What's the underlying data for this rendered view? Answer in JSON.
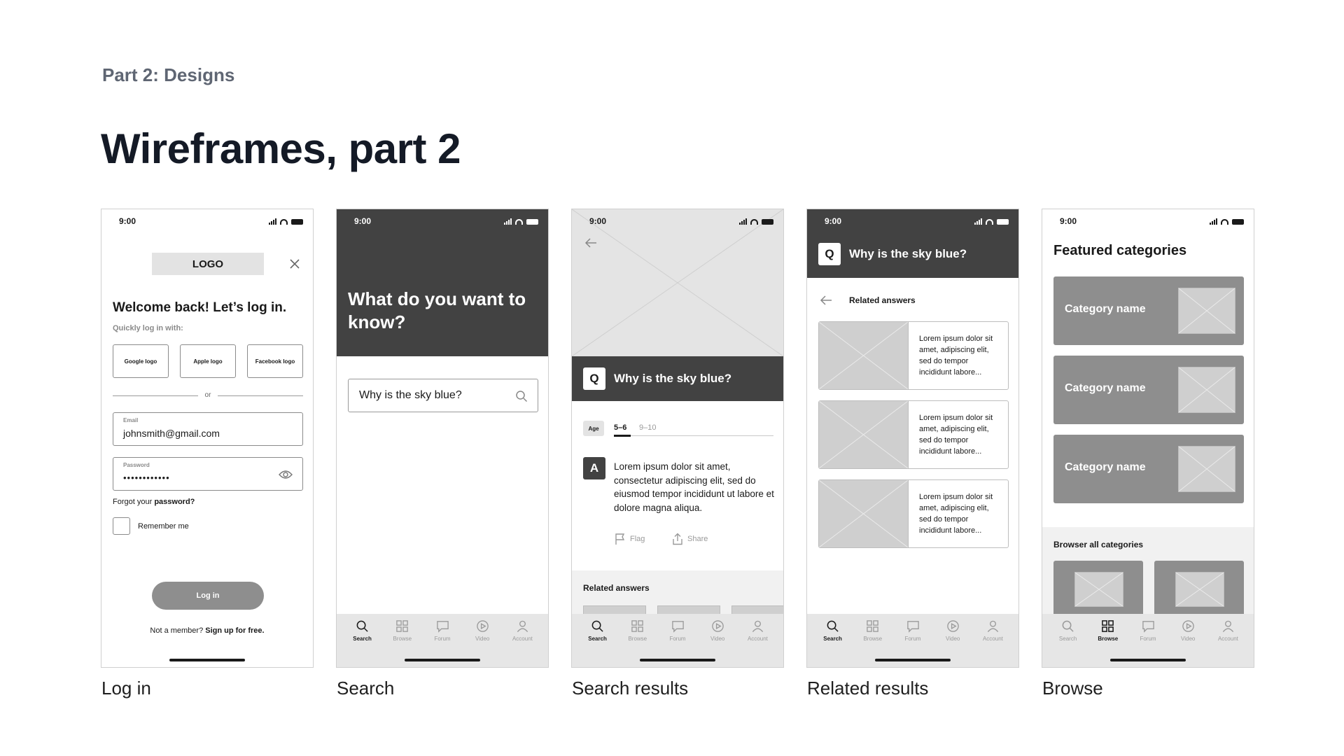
{
  "header": {
    "eyebrow": "Part 2: Designs",
    "title": "Wireframes, part 2"
  },
  "status_time": "9:00",
  "tabbar": [
    "Search",
    "Browse",
    "Forum",
    "Video",
    "Account"
  ],
  "screens": {
    "login": {
      "caption": "Log in",
      "logo": "LOGO",
      "heading": "Welcome back! Let’s log in.",
      "subheading": "Quickly log in with:",
      "social": [
        "Google logo",
        "Apple logo",
        "Facebook logo"
      ],
      "or": "or",
      "email_label": "Email",
      "email_value": "johnsmith@gmail.com",
      "password_label": "Password",
      "password_value": "••••••••••••",
      "forgot_prefix": "Forgot your ",
      "forgot_link": "password?",
      "remember": "Remember me",
      "login_button": "Log in",
      "signup_prefix": "Not a member? ",
      "signup_link": "Sign up for free."
    },
    "search": {
      "caption": "Search",
      "hero_question": "What do you want to know?",
      "search_value": "Why is the sky blue?"
    },
    "results": {
      "caption": "Search results",
      "question": "Why is the sky blue?",
      "q_badge": "Q",
      "a_badge": "A",
      "age_chip": "Age",
      "age_options": [
        "5–6",
        "9–10"
      ],
      "answer": "Lorem ipsum dolor sit amet, consectetur adipiscing elit, sed do eiusmod tempor incididunt ut labore et dolore magna aliqua.",
      "flag": "Flag",
      "share": "Share",
      "related": "Related answers"
    },
    "related": {
      "caption": "Related results",
      "question": "Why is the sky blue?",
      "q_badge": "Q",
      "heading": "Related answers",
      "cards": [
        "Lorem ipsum dolor sit amet, adipiscing elit, sed do tempor incididunt labore...",
        "Lorem ipsum dolor sit amet, adipiscing elit, sed do tempor incididunt labore...",
        "Lorem ipsum dolor sit amet, adipiscing elit, sed do tempor incididunt labore..."
      ]
    },
    "browse": {
      "caption": "Browse",
      "heading": "Featured categories",
      "categories": [
        "Category name",
        "Category name",
        "Category name"
      ],
      "all_heading": "Browser all categories"
    }
  }
}
